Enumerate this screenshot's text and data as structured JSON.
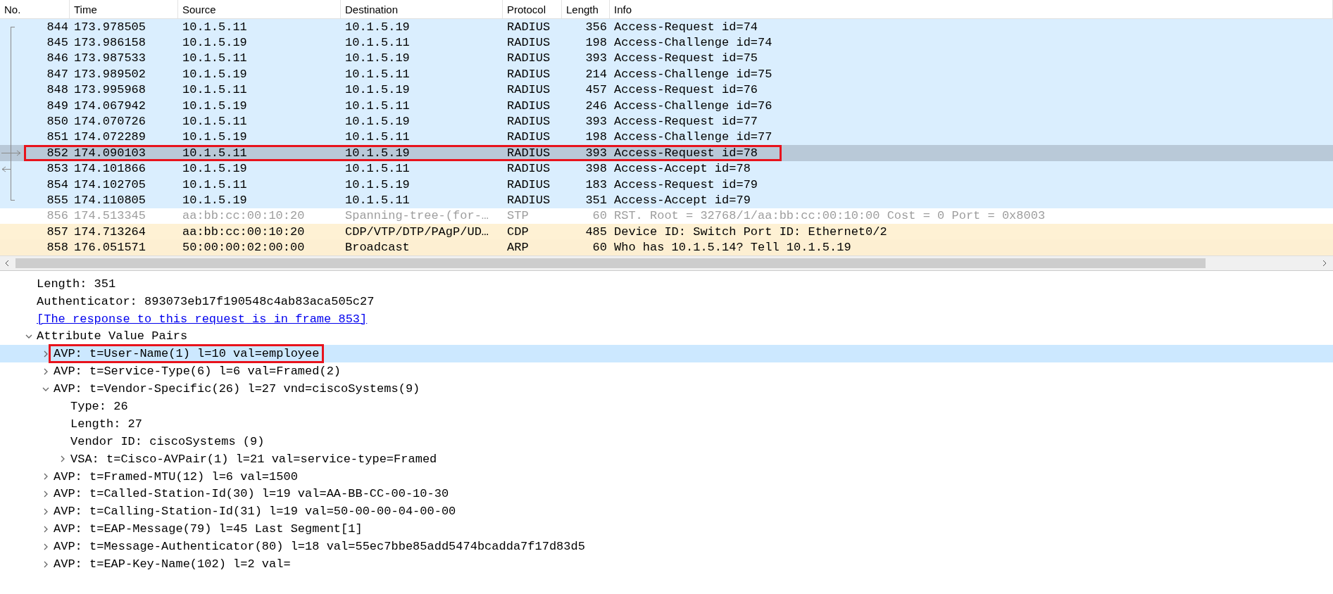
{
  "columns": [
    "No.",
    "Time",
    "Source",
    "Destination",
    "Protocol",
    "Length",
    "Info"
  ],
  "packets": [
    {
      "no": "844",
      "time": "173.978505",
      "source": "10.1.5.11",
      "destination": "10.1.5.19",
      "protocol": "RADIUS",
      "length": "356",
      "info": "Access-Request id=74",
      "kind": "radius",
      "in_conversation": true,
      "request_arrow": false,
      "response_arrow": false,
      "selected": false,
      "highlighted": false
    },
    {
      "no": "845",
      "time": "173.986158",
      "source": "10.1.5.19",
      "destination": "10.1.5.11",
      "protocol": "RADIUS",
      "length": "198",
      "info": "Access-Challenge id=74",
      "kind": "radius",
      "in_conversation": true,
      "request_arrow": false,
      "response_arrow": false,
      "selected": false,
      "highlighted": false
    },
    {
      "no": "846",
      "time": "173.987533",
      "source": "10.1.5.11",
      "destination": "10.1.5.19",
      "protocol": "RADIUS",
      "length": "393",
      "info": "Access-Request id=75",
      "kind": "radius",
      "in_conversation": true,
      "request_arrow": false,
      "response_arrow": false,
      "selected": false,
      "highlighted": false
    },
    {
      "no": "847",
      "time": "173.989502",
      "source": "10.1.5.19",
      "destination": "10.1.5.11",
      "protocol": "RADIUS",
      "length": "214",
      "info": "Access-Challenge id=75",
      "kind": "radius",
      "in_conversation": true,
      "request_arrow": false,
      "response_arrow": false,
      "selected": false,
      "highlighted": false
    },
    {
      "no": "848",
      "time": "173.995968",
      "source": "10.1.5.11",
      "destination": "10.1.5.19",
      "protocol": "RADIUS",
      "length": "457",
      "info": "Access-Request id=76",
      "kind": "radius",
      "in_conversation": true,
      "request_arrow": false,
      "response_arrow": false,
      "selected": false,
      "highlighted": false
    },
    {
      "no": "849",
      "time": "174.067942",
      "source": "10.1.5.19",
      "destination": "10.1.5.11",
      "protocol": "RADIUS",
      "length": "246",
      "info": "Access-Challenge id=76",
      "kind": "radius",
      "in_conversation": true,
      "request_arrow": false,
      "response_arrow": false,
      "selected": false,
      "highlighted": false
    },
    {
      "no": "850",
      "time": "174.070726",
      "source": "10.1.5.11",
      "destination": "10.1.5.19",
      "protocol": "RADIUS",
      "length": "393",
      "info": "Access-Request id=77",
      "kind": "radius",
      "in_conversation": true,
      "request_arrow": false,
      "response_arrow": false,
      "selected": false,
      "highlighted": false
    },
    {
      "no": "851",
      "time": "174.072289",
      "source": "10.1.5.19",
      "destination": "10.1.5.11",
      "protocol": "RADIUS",
      "length": "198",
      "info": "Access-Challenge id=77",
      "kind": "radius",
      "in_conversation": true,
      "request_arrow": false,
      "response_arrow": false,
      "selected": false,
      "highlighted": false
    },
    {
      "no": "852",
      "time": "174.090103",
      "source": "10.1.5.11",
      "destination": "10.1.5.19",
      "protocol": "RADIUS",
      "length": "393",
      "info": "Access-Request id=78",
      "kind": "radius",
      "in_conversation": true,
      "request_arrow": true,
      "response_arrow": false,
      "selected": true,
      "highlighted": true
    },
    {
      "no": "853",
      "time": "174.101866",
      "source": "10.1.5.19",
      "destination": "10.1.5.11",
      "protocol": "RADIUS",
      "length": "398",
      "info": "Access-Accept id=78",
      "kind": "radius",
      "in_conversation": true,
      "request_arrow": false,
      "response_arrow": true,
      "selected": false,
      "highlighted": false
    },
    {
      "no": "854",
      "time": "174.102705",
      "source": "10.1.5.11",
      "destination": "10.1.5.19",
      "protocol": "RADIUS",
      "length": "183",
      "info": "Access-Request id=79",
      "kind": "radius",
      "in_conversation": true,
      "request_arrow": false,
      "response_arrow": false,
      "selected": false,
      "highlighted": false
    },
    {
      "no": "855",
      "time": "174.110805",
      "source": "10.1.5.19",
      "destination": "10.1.5.11",
      "protocol": "RADIUS",
      "length": "351",
      "info": "Access-Accept id=79",
      "kind": "radius",
      "in_conversation": true,
      "request_arrow": false,
      "response_arrow": false,
      "selected": false,
      "highlighted": false
    },
    {
      "no": "856",
      "time": "174.513345",
      "source": "aa:bb:cc:00:10:20",
      "destination": "Spanning-tree-(for-…",
      "protocol": "STP",
      "length": "60",
      "info": "RST. Root = 32768/1/aa:bb:cc:00:10:00  Cost = 0  Port = 0x8003",
      "kind": "stp",
      "in_conversation": false,
      "request_arrow": false,
      "response_arrow": false,
      "selected": false,
      "highlighted": false
    },
    {
      "no": "857",
      "time": "174.713264",
      "source": "aa:bb:cc:00:10:20",
      "destination": "CDP/VTP/DTP/PAgP/UD…",
      "protocol": "CDP",
      "length": "485",
      "info": "Device ID: Switch  Port ID: Ethernet0/2",
      "kind": "cdp",
      "in_conversation": false,
      "request_arrow": false,
      "response_arrow": false,
      "selected": false,
      "highlighted": false
    },
    {
      "no": "858",
      "time": "176.051571",
      "source": "50:00:00:02:00:00",
      "destination": "Broadcast",
      "protocol": "ARP",
      "length": "60",
      "info": "Who has 10.1.5.14? Tell 10.1.5.19",
      "kind": "arp",
      "in_conversation": false,
      "request_arrow": false,
      "response_arrow": false,
      "selected": false,
      "highlighted": false
    }
  ],
  "details": [
    {
      "text": "Length: 351",
      "kind": "field",
      "selected": false,
      "highlighted": false
    },
    {
      "text": "Authenticator: 893073eb17f190548c4ab83aca505c27",
      "kind": "field",
      "selected": false,
      "highlighted": false
    },
    {
      "text": "[The response to this request is in frame 853]",
      "kind": "link",
      "selected": false,
      "highlighted": false
    },
    {
      "text": "Attribute Value Pairs",
      "kind": "field",
      "expanded": true,
      "selected": false,
      "highlighted": false,
      "children": [
        {
          "text": "AVP: t=User-Name(1) l=10 val=employee",
          "kind": "field",
          "expanded": false,
          "selected": true,
          "highlighted": true
        },
        {
          "text": "AVP: t=Service-Type(6) l=6 val=Framed(2)",
          "kind": "field",
          "expanded": false,
          "selected": false,
          "highlighted": false
        },
        {
          "text": "AVP: t=Vendor-Specific(26) l=27 vnd=ciscoSystems(9)",
          "kind": "field",
          "expanded": true,
          "selected": false,
          "highlighted": false,
          "children": [
            {
              "text": "Type: 26",
              "kind": "field",
              "selected": false,
              "highlighted": false
            },
            {
              "text": "Length: 27",
              "kind": "field",
              "selected": false,
              "highlighted": false
            },
            {
              "text": "Vendor ID: ciscoSystems (9)",
              "kind": "field",
              "selected": false,
              "highlighted": false
            },
            {
              "text": "VSA: t=Cisco-AVPair(1) l=21 val=service-type=Framed",
              "kind": "field",
              "expanded": false,
              "selected": false,
              "highlighted": false
            }
          ]
        },
        {
          "text": "AVP: t=Framed-MTU(12) l=6 val=1500",
          "kind": "field",
          "expanded": false,
          "selected": false,
          "highlighted": false
        },
        {
          "text": "AVP: t=Called-Station-Id(30) l=19 val=AA-BB-CC-00-10-30",
          "kind": "field",
          "expanded": false,
          "selected": false,
          "highlighted": false
        },
        {
          "text": "AVP: t=Calling-Station-Id(31) l=19 val=50-00-00-04-00-00",
          "kind": "field",
          "expanded": false,
          "selected": false,
          "highlighted": false
        },
        {
          "text": "AVP: t=EAP-Message(79) l=45 Last Segment[1]",
          "kind": "field",
          "expanded": false,
          "selected": false,
          "highlighted": false
        },
        {
          "text": "AVP: t=Message-Authenticator(80) l=18 val=55ec7bbe85add5474bcadda7f17d83d5",
          "kind": "field",
          "expanded": false,
          "selected": false,
          "highlighted": false
        },
        {
          "text": "AVP: t=EAP-Key-Name(102) l=2 val=",
          "kind": "field",
          "expanded": false,
          "selected": false,
          "highlighted": false
        }
      ]
    }
  ]
}
